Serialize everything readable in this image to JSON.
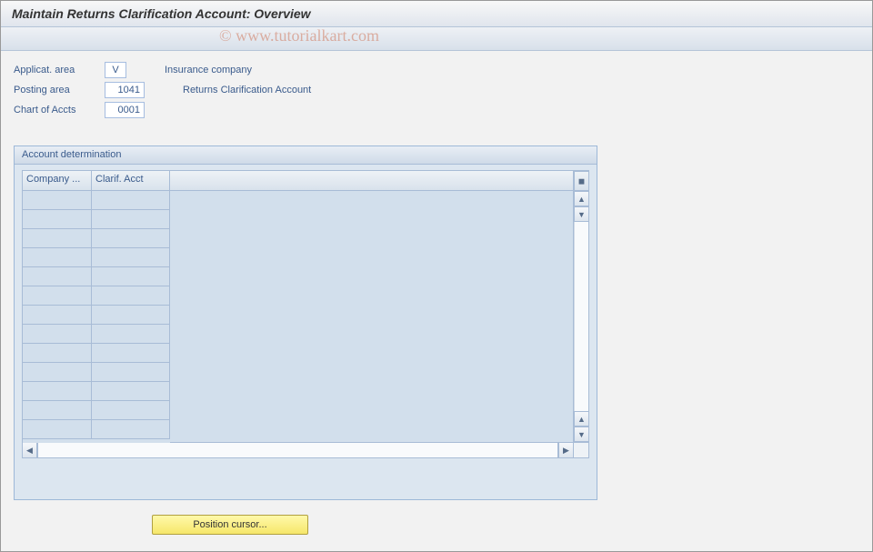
{
  "title": "Maintain Returns Clarification Account: Overview",
  "watermark": "© www.tutorialkart.com",
  "fields": {
    "applicat": {
      "label": "Applicat. area",
      "value": "V",
      "desc": "Insurance company"
    },
    "posting": {
      "label": "Posting area",
      "value": "1041",
      "desc": "Returns Clarification Account"
    },
    "chart": {
      "label": "Chart of Accts",
      "value": "0001",
      "desc": ""
    }
  },
  "panel": {
    "title": "Account determination",
    "columns": [
      "Company ...",
      "Clarif. Acct"
    ],
    "rows": [
      {
        "company": "",
        "acct": ""
      },
      {
        "company": "",
        "acct": ""
      },
      {
        "company": "",
        "acct": ""
      },
      {
        "company": "",
        "acct": ""
      },
      {
        "company": "",
        "acct": ""
      },
      {
        "company": "",
        "acct": ""
      },
      {
        "company": "",
        "acct": ""
      },
      {
        "company": "",
        "acct": ""
      },
      {
        "company": "",
        "acct": ""
      },
      {
        "company": "",
        "acct": ""
      },
      {
        "company": "",
        "acct": ""
      },
      {
        "company": "",
        "acct": ""
      },
      {
        "company": "",
        "acct": ""
      }
    ]
  },
  "buttons": {
    "position": "Position cursor..."
  }
}
